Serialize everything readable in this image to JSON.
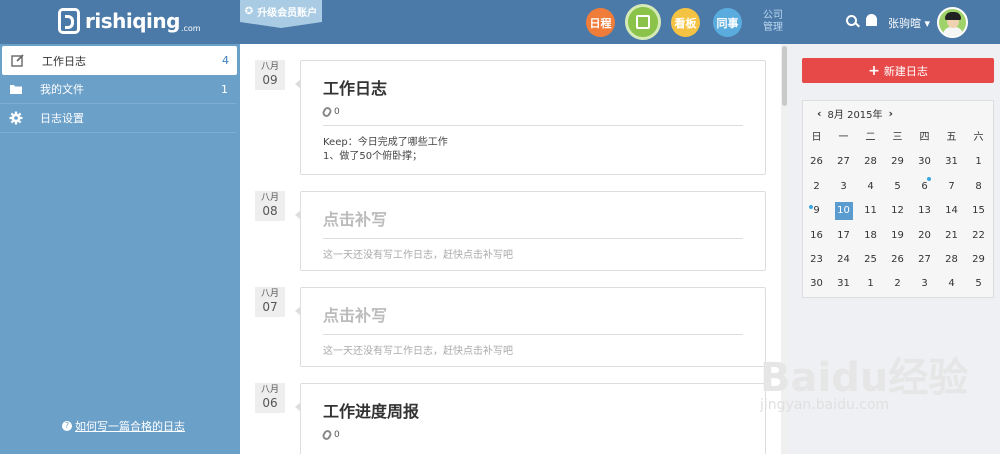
{
  "header": {
    "logo_text": "rishiqing",
    "logo_suffix": ".com",
    "ribbon": "升级会员账户",
    "nav": [
      {
        "label": "日程",
        "color": "#f07c3a"
      },
      {
        "label": "",
        "color": "#8bc34a"
      },
      {
        "label": "看板",
        "color": "#f5c344"
      },
      {
        "label": "同事",
        "color": "#5aabde"
      }
    ],
    "corp_label": "公司管理",
    "user_name": "张驹暄"
  },
  "sidebar": {
    "items": [
      {
        "label": "工作日志",
        "count": "4",
        "icon": "edit-icon"
      },
      {
        "label": "我的文件",
        "count": "1",
        "icon": "folder-icon"
      },
      {
        "label": "日志设置",
        "count": "",
        "icon": "gear-icon"
      }
    ],
    "help": "如何写一篇合格的日志"
  },
  "entries": [
    {
      "month": "八月",
      "day": "09",
      "title": "工作日志",
      "attachments": "0",
      "body1": "Keep：今日完成了哪些工作",
      "body2": "1、做了50个俯卧撑；"
    },
    {
      "month": "八月",
      "day": "08",
      "title": "点击补写",
      "body1": "这一天还没有写工作日志，赶快点击补写吧"
    },
    {
      "month": "八月",
      "day": "07",
      "title": "点击补写",
      "body1": "这一天还没有写工作日志，赶快点击补写吧"
    },
    {
      "month": "八月",
      "day": "06",
      "title": "工作进度周报",
      "attachments": "0"
    }
  ],
  "right": {
    "new_button": "新建日志",
    "calendar": {
      "title": "8月 2015年",
      "weekdays": [
        "日",
        "一",
        "二",
        "三",
        "四",
        "五",
        "六"
      ],
      "days": [
        "26",
        "27",
        "28",
        "29",
        "30",
        "31",
        "1",
        "2",
        "3",
        "4",
        "5",
        "6",
        "7",
        "8",
        "9",
        "10",
        "11",
        "12",
        "13",
        "14",
        "15",
        "16",
        "17",
        "18",
        "19",
        "20",
        "21",
        "22",
        "23",
        "24",
        "25",
        "26",
        "27",
        "28",
        "29",
        "30",
        "31",
        "1",
        "2",
        "3",
        "4",
        "5"
      ],
      "today": "10",
      "marked": [
        "6",
        "9"
      ]
    }
  },
  "watermark": {
    "brand": "Baidu经验",
    "url": "jingyan.baidu.com"
  }
}
